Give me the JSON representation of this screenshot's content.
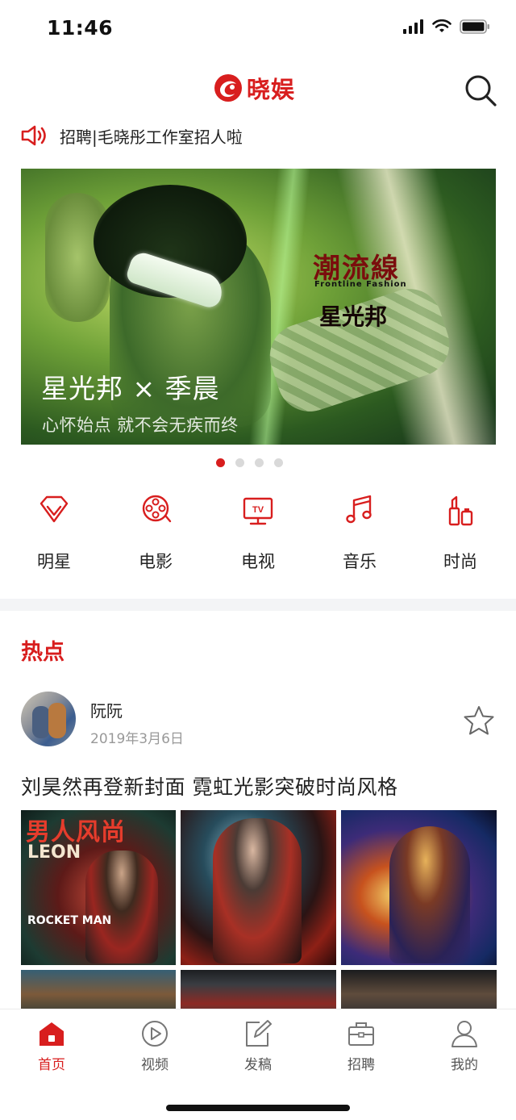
{
  "status_bar": {
    "time": "11:46"
  },
  "header": {
    "logo_text": "晓娱",
    "search_icon": "search-icon"
  },
  "notice": {
    "icon": "speaker-icon",
    "text": "招聘|毛晓彤工作室招人啦"
  },
  "banner": {
    "caption_title": "星光邦 × 季晨",
    "caption_subtitle": "心怀始点 就不会无疾而终",
    "magazine_title": "潮流線",
    "magazine_subtitle": "Frontline Fashion",
    "magazine_brand": "星光邦",
    "pagination": {
      "total": 4,
      "active": 1
    }
  },
  "categories": [
    {
      "label": "明星",
      "icon": "diamond-icon"
    },
    {
      "label": "电影",
      "icon": "film-reel-icon"
    },
    {
      "label": "电视",
      "icon": "tv-icon"
    },
    {
      "label": "音乐",
      "icon": "music-note-icon"
    },
    {
      "label": "时尚",
      "icon": "lipstick-icon"
    }
  ],
  "hot_section": {
    "title": "热点",
    "post": {
      "author": "阮阮",
      "date": "2019年3月6日",
      "title": "刘昊然再登新封面 霓虹光影突破时尚风格",
      "cover_text": {
        "magazine": "男人风尚",
        "brand": "LEON",
        "headline": "ROCKET MAN"
      }
    }
  },
  "tab_bar": {
    "items": [
      {
        "label": "首页",
        "icon": "home-icon",
        "active": true
      },
      {
        "label": "视频",
        "icon": "play-icon",
        "active": false
      },
      {
        "label": "发稿",
        "icon": "edit-icon",
        "active": false
      },
      {
        "label": "招聘",
        "icon": "briefcase-icon",
        "active": false
      },
      {
        "label": "我的",
        "icon": "user-icon",
        "active": false
      }
    ]
  },
  "colors": {
    "accent": "#d81e1e",
    "text": "#222222",
    "muted": "#999999",
    "divider": "#f3f4f6"
  }
}
